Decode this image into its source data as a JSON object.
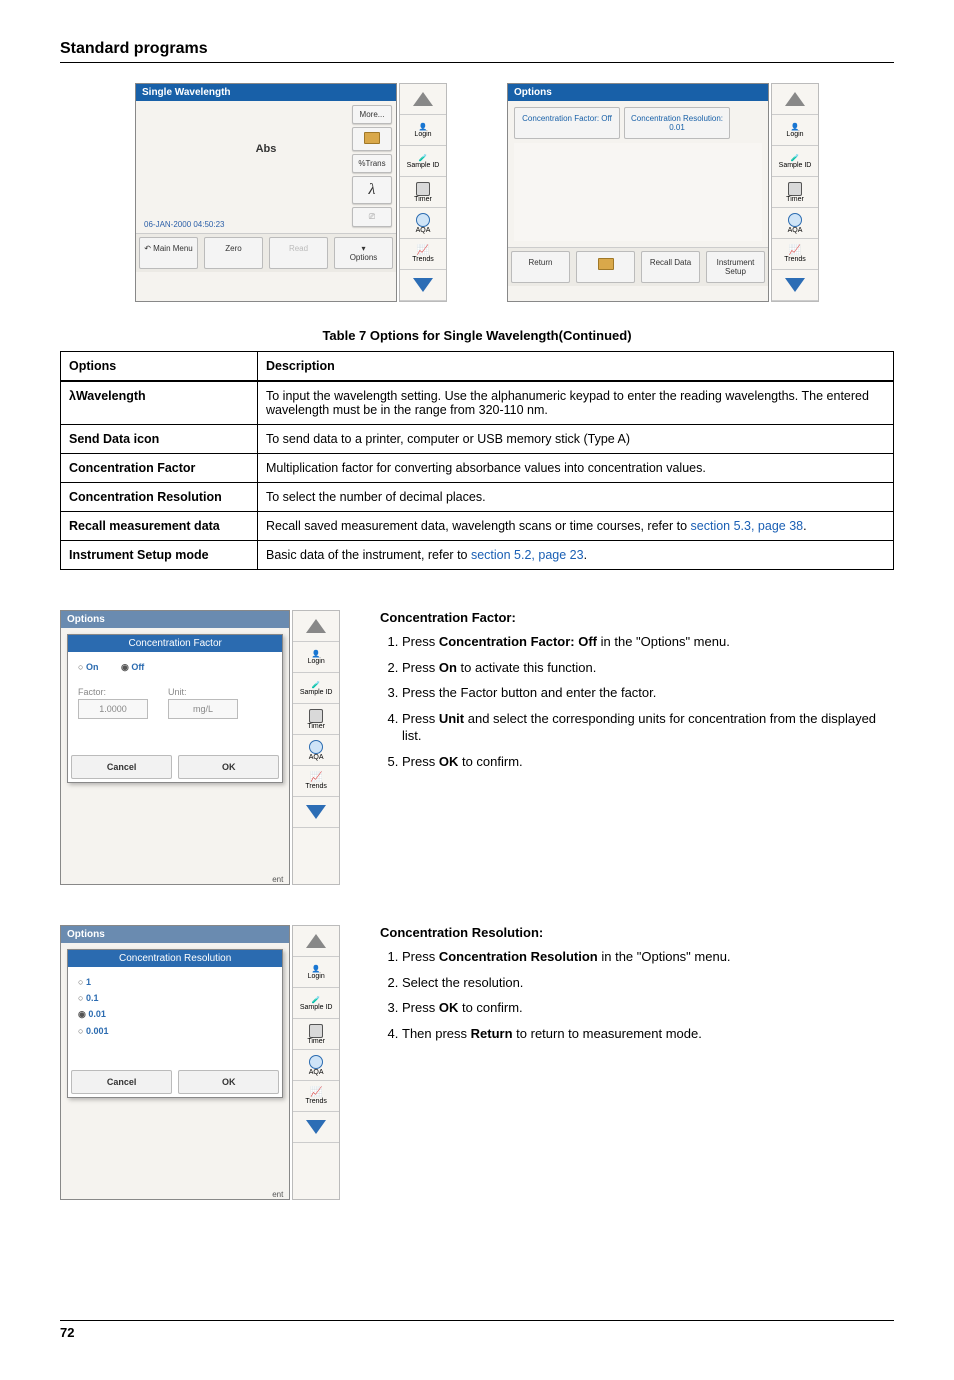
{
  "page": {
    "title": "Standard programs",
    "number": "72"
  },
  "table": {
    "caption": "Table 7 Options for Single Wavelength(Continued)",
    "headers": [
      "Options",
      "Description"
    ],
    "rows": [
      {
        "name": "λWavelength",
        "desc": "To input the wavelength setting. Use the alphanumeric keypad to enter the reading wavelengths. The entered wavelength must be in the range from 320-110 nm."
      },
      {
        "name": "Send Data icon",
        "desc": "To send data to a printer, computer or USB memory stick (Type A)"
      },
      {
        "name": "Concentration Factor",
        "desc": "Multiplication factor for converting absorbance values into concentration values."
      },
      {
        "name": "Concentration Resolution",
        "desc": "To select the number of decimal places."
      },
      {
        "name": "Recall measurement data",
        "desc_pre": "Recall saved measurement data, wavelength scans or time courses, refer to ",
        "link": "section 5.3, page 38",
        "desc_post": "."
      },
      {
        "name": "Instrument Setup mode",
        "desc_pre": "Basic data of the instrument, refer to ",
        "link": "section 5.2, page 23",
        "desc_post": "."
      }
    ]
  },
  "screen1": {
    "title": "Single Wavelength",
    "abs": "Abs",
    "datetime": "06-JAN-2000  04:50:23",
    "side": {
      "more": "More...",
      "pTrans": "%Trans"
    },
    "bottom": {
      "main": "Main Menu",
      "zero": "Zero",
      "read": "Read",
      "options": "Options"
    }
  },
  "screen2": {
    "title": "Options",
    "conc_factor": "Concentration Factor: Off",
    "conc_res": "Concentration Resolution: 0.01",
    "bottom": {
      "return": "Return",
      "recall": "Recall Data",
      "setup": "Instrument Setup"
    }
  },
  "iconPanel": {
    "login": "Login",
    "sample": "Sample ID",
    "timer": "Timer",
    "aqa": "AQA",
    "trends": "Trends"
  },
  "dialog1": {
    "bg_title": "Options",
    "title": "Concentration Factor",
    "on": "On",
    "off": "Off",
    "factor_lbl": "Factor:",
    "factor_val": "1.0000",
    "unit_lbl": "Unit:",
    "unit_val": "mg/L",
    "cancel": "Cancel",
    "ok": "OK",
    "behind": "ent"
  },
  "dialog2": {
    "bg_title": "Options",
    "title": "Concentration Resolution",
    "opts": [
      "1",
      "0.1",
      "0.01",
      "0.001"
    ],
    "selected": "0.01",
    "cancel": "Cancel",
    "ok": "OK",
    "behind": "ent"
  },
  "instr1": {
    "heading": "Concentration Factor:",
    "steps": [
      {
        "pre": "Press ",
        "bold": "Concentration Factor: Off",
        "post": " in the \"Options\" menu."
      },
      {
        "pre": "Press ",
        "bold": "On",
        "post": "  to activate this function."
      },
      {
        "plain": "Press the Factor button and enter the factor."
      },
      {
        "pre": "Press ",
        "bold": "Unit",
        "post": " and select the corresponding units for concentration from the displayed list."
      },
      {
        "pre": "Press ",
        "bold": "OK",
        "post": " to confirm."
      }
    ]
  },
  "instr2": {
    "heading": "Concentration Resolution:",
    "steps": [
      {
        "pre": "Press ",
        "bold": "Concentration Resolution",
        "post": " in the \"Options\" menu."
      },
      {
        "plain": "Select the resolution."
      },
      {
        "pre": "Press ",
        "bold": "OK",
        "post": " to confirm."
      },
      {
        "pre": "Then press ",
        "bold": "Return",
        "post": " to return to measurement mode."
      }
    ]
  }
}
